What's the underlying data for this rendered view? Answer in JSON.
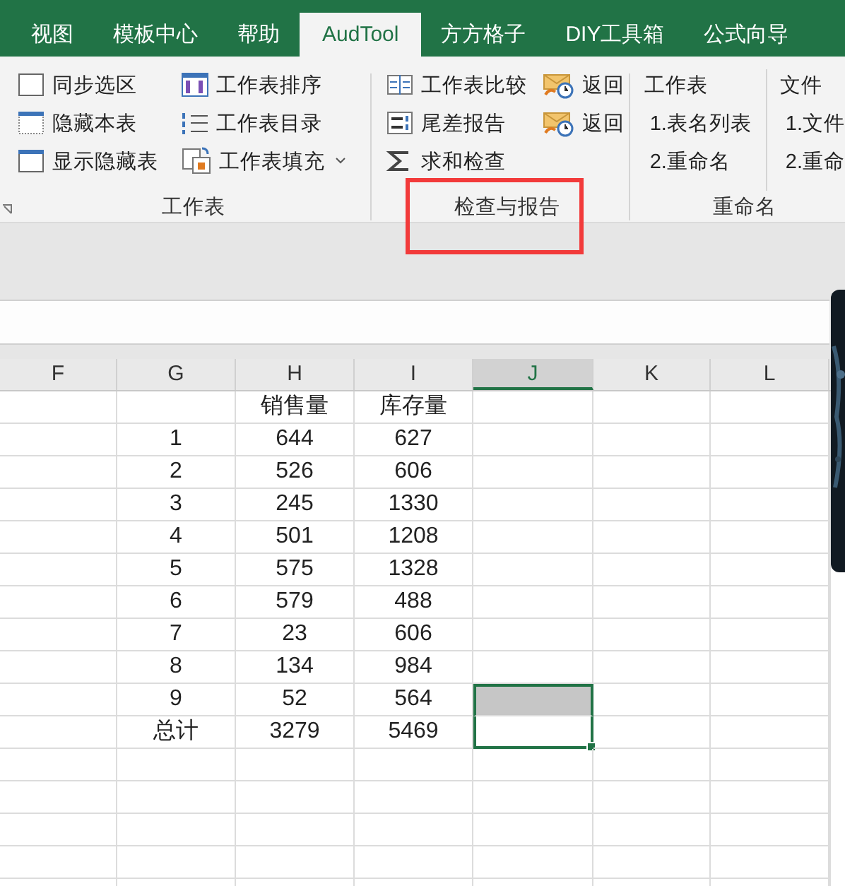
{
  "tabs": [
    {
      "label": "视图",
      "selected": false
    },
    {
      "label": "模板中心",
      "selected": false
    },
    {
      "label": "帮助",
      "selected": false
    },
    {
      "label": "AudTool",
      "selected": true
    },
    {
      "label": "方方格子",
      "selected": false
    },
    {
      "label": "DIY工具箱",
      "selected": false
    },
    {
      "label": "公式向导",
      "selected": false
    }
  ],
  "ribbon_groups": [
    {
      "label": "工作表",
      "highlighted": false,
      "columns": [
        [
          {
            "label": "同步选区",
            "kind": "box"
          },
          {
            "label": "隐藏本表",
            "kind": "box-dotted"
          },
          {
            "label": "显示隐藏表",
            "kind": "box-bar"
          }
        ],
        [
          {
            "label": "工作表排序",
            "kind": "sort"
          },
          {
            "label": "工作表目录",
            "kind": "list"
          },
          {
            "label": "工作表填充",
            "kind": "fill",
            "dropdown": true
          }
        ]
      ]
    },
    {
      "label": "检查与报告",
      "highlighted": true,
      "columns": [
        [
          {
            "label": "工作表比较",
            "kind": "compare"
          },
          {
            "label": "尾差报告",
            "kind": "numbers"
          },
          {
            "label": "求和检查",
            "kind": "sigma"
          }
        ],
        [
          {
            "label": "返回",
            "kind": "mail"
          },
          {
            "label": "返回",
            "kind": "mail"
          }
        ]
      ]
    },
    {
      "label": "重命名",
      "highlighted": false,
      "columns": [
        [
          {
            "label": "工作表",
            "kind": "none"
          },
          {
            "label": "1.表名列表",
            "kind": "none"
          },
          {
            "label": "2.重命名",
            "kind": "none"
          }
        ],
        [
          {
            "label": "文件",
            "kind": "none"
          },
          {
            "label": "1.文件",
            "kind": "none"
          },
          {
            "label": "2.重命",
            "kind": "none"
          }
        ]
      ]
    }
  ],
  "columns": [
    {
      "label": "F",
      "selected": false
    },
    {
      "label": "G",
      "selected": false
    },
    {
      "label": "H",
      "selected": false
    },
    {
      "label": "I",
      "selected": false
    },
    {
      "label": "J",
      "selected": true
    },
    {
      "label": "K",
      "selected": false
    },
    {
      "label": "L",
      "selected": false
    }
  ],
  "rows": [
    {
      "cells": [
        "",
        "销售量",
        "库存量"
      ],
      "selected": false
    },
    {
      "cells": [
        "1",
        "644",
        "627"
      ],
      "selected": false
    },
    {
      "cells": [
        "2",
        "526",
        "606"
      ],
      "selected": false
    },
    {
      "cells": [
        "3",
        "245",
        "1330"
      ],
      "selected": false
    },
    {
      "cells": [
        "4",
        "501",
        "1208"
      ],
      "selected": false
    },
    {
      "cells": [
        "5",
        "575",
        "1328"
      ],
      "selected": false
    },
    {
      "cells": [
        "6",
        "579",
        "488"
      ],
      "selected": false
    },
    {
      "cells": [
        "7",
        "23",
        "606"
      ],
      "selected": false
    },
    {
      "cells": [
        "8",
        "134",
        "984"
      ],
      "selected": false
    },
    {
      "cells": [
        "9",
        "52",
        "564"
      ],
      "selected": true
    },
    {
      "cells": [
        "总计",
        "3279",
        "5469"
      ],
      "selected": true
    }
  ]
}
